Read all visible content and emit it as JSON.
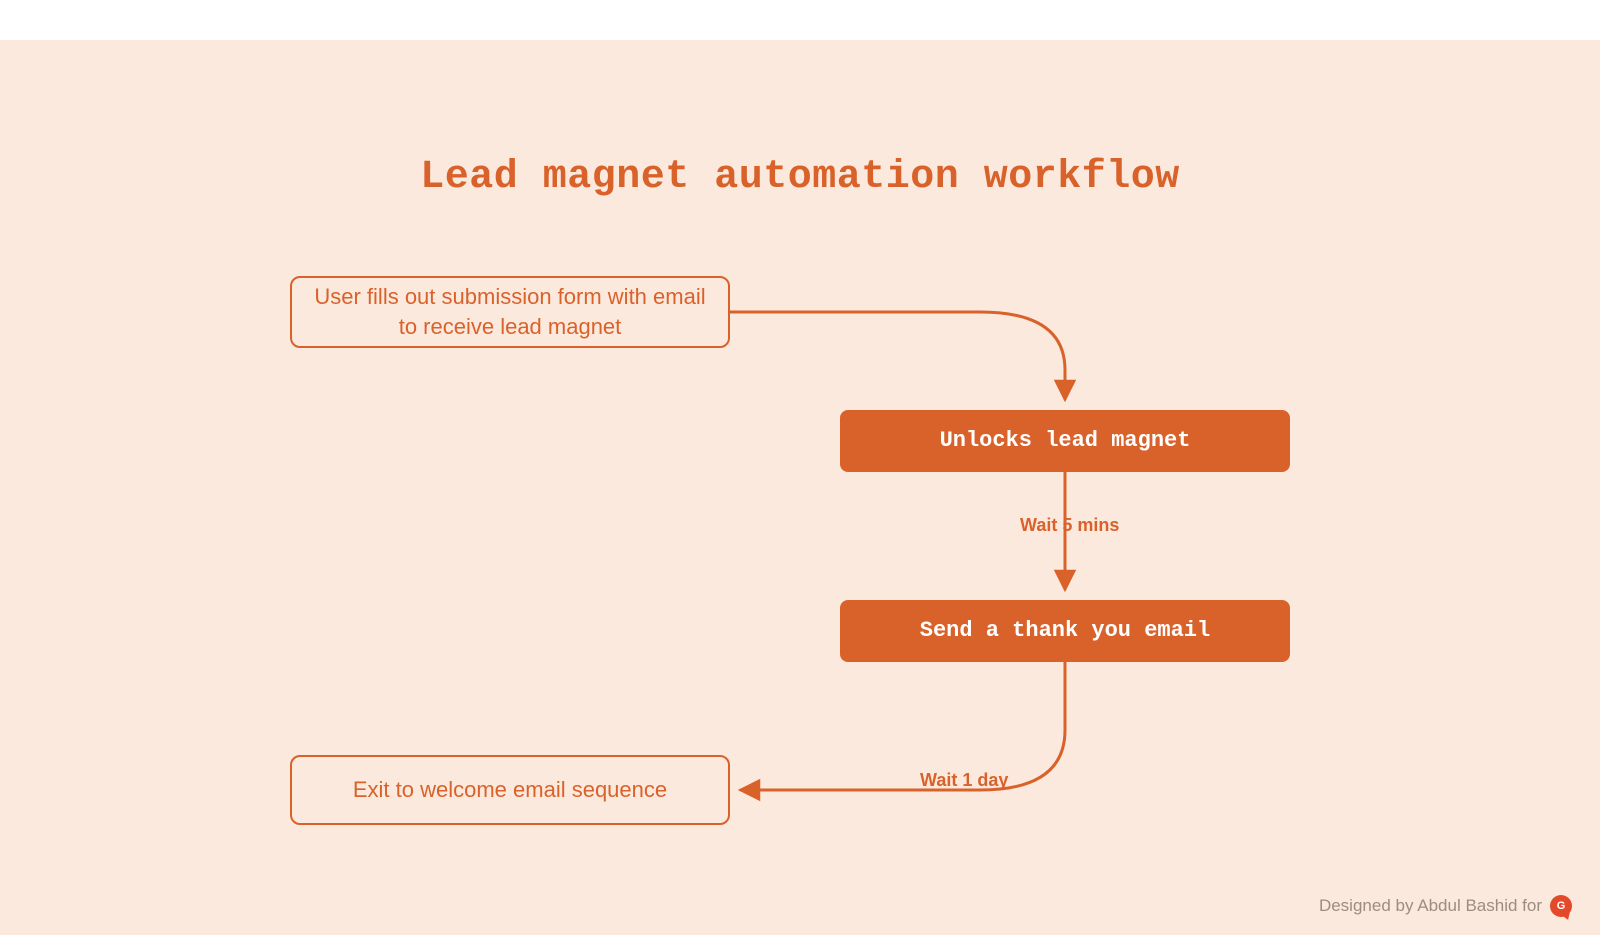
{
  "title": "Lead magnet automation workflow",
  "nodes": {
    "start": "User fills out submission form with email to receive lead magnet",
    "unlock": "Unlocks lead magnet",
    "thankyou": "Send a thank you email",
    "exit": "Exit to welcome email sequence"
  },
  "edges": {
    "wait5": "Wait 5 mins",
    "wait1day": "Wait 1 day"
  },
  "footer": {
    "text": "Designed by Abdul Bashid for",
    "logo_label": "G2"
  },
  "colors": {
    "accent": "#d9622b",
    "bg": "#fce9dd"
  }
}
